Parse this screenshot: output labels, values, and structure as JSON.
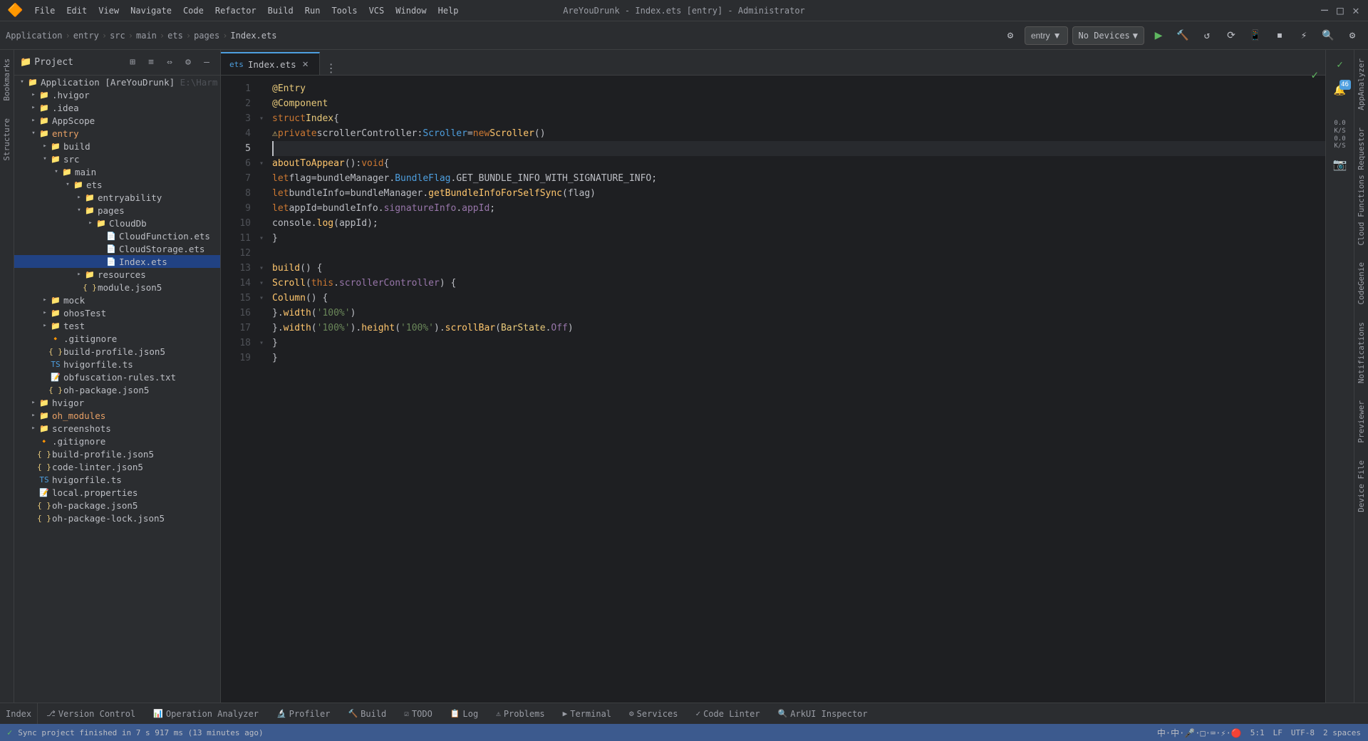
{
  "window": {
    "title": "AreYouDrunk - Index.ets [entry] - Administrator",
    "controls": [
      "–",
      "□",
      "✕"
    ]
  },
  "menu": {
    "logo": "🔶",
    "items": [
      "File",
      "Edit",
      "View",
      "Navigate",
      "Code",
      "Refactor",
      "Build",
      "Run",
      "Tools",
      "VCS",
      "Window",
      "Help"
    ]
  },
  "toolbar": {
    "breadcrumb": [
      "Application",
      "entry",
      "src",
      "main",
      "ets",
      "pages",
      "Index.ets"
    ],
    "entry_dropdown": "entry",
    "no_devices": "No Devices",
    "search_icon": "🔍",
    "settings_icon": "⚙"
  },
  "project_panel": {
    "title": "Project",
    "tree": [
      {
        "id": "app-root",
        "label": "Application [AreYouDrunk]",
        "suffix": "E:\\Harm",
        "indent": 0,
        "type": "dir-root",
        "expanded": true
      },
      {
        "id": "hvigor",
        "label": ".hvigor",
        "indent": 1,
        "type": "dir",
        "expanded": false
      },
      {
        "id": "idea",
        "label": ".idea",
        "indent": 1,
        "type": "dir",
        "expanded": false
      },
      {
        "id": "appscope",
        "label": "AppScope",
        "indent": 1,
        "type": "dir",
        "expanded": false
      },
      {
        "id": "entry",
        "label": "entry",
        "indent": 1,
        "type": "dir-orange",
        "expanded": true
      },
      {
        "id": "build",
        "label": "build",
        "indent": 2,
        "type": "dir",
        "expanded": false
      },
      {
        "id": "src",
        "label": "src",
        "indent": 2,
        "type": "dir",
        "expanded": true
      },
      {
        "id": "main",
        "label": "main",
        "indent": 3,
        "type": "dir",
        "expanded": true
      },
      {
        "id": "ets",
        "label": "ets",
        "indent": 4,
        "type": "dir",
        "expanded": true
      },
      {
        "id": "entryability",
        "label": "entryability",
        "indent": 5,
        "type": "dir",
        "expanded": false
      },
      {
        "id": "pages",
        "label": "pages",
        "indent": 5,
        "type": "dir",
        "expanded": true
      },
      {
        "id": "clouddb",
        "label": "CloudDb",
        "indent": 6,
        "type": "dir",
        "expanded": false
      },
      {
        "id": "cloudfunctionets",
        "label": "CloudFunction.ets",
        "indent": 6,
        "type": "file-ets"
      },
      {
        "id": "cloudstorageEts",
        "label": "CloudStorage.ets",
        "indent": 6,
        "type": "file-ets"
      },
      {
        "id": "indexets",
        "label": "Index.ets",
        "indent": 6,
        "type": "file-ets",
        "selected": true
      },
      {
        "id": "resources",
        "label": "resources",
        "indent": 4,
        "type": "dir",
        "expanded": false
      },
      {
        "id": "modulejson5",
        "label": "module.json5",
        "indent": 4,
        "type": "file-json"
      },
      {
        "id": "mock",
        "label": "mock",
        "indent": 2,
        "type": "dir",
        "expanded": false
      },
      {
        "id": "ohostest",
        "label": "ohosTest",
        "indent": 2,
        "type": "dir",
        "expanded": false
      },
      {
        "id": "test",
        "label": "test",
        "indent": 2,
        "type": "dir",
        "expanded": false
      },
      {
        "id": "gitignore1",
        "label": ".gitignore",
        "indent": 2,
        "type": "file-git"
      },
      {
        "id": "buildprofilejson5",
        "label": "build-profile.json5",
        "indent": 2,
        "type": "file-json"
      },
      {
        "id": "hvigorfile",
        "label": "hvigorfile.ts",
        "indent": 2,
        "type": "file-ts"
      },
      {
        "id": "obfuscation",
        "label": "obfuscation-rules.txt",
        "indent": 2,
        "type": "file-txt"
      },
      {
        "id": "ohpackage",
        "label": "oh-package.json5",
        "indent": 2,
        "type": "file-json"
      },
      {
        "id": "hvigor-dir",
        "label": "hvigor",
        "indent": 1,
        "type": "dir",
        "expanded": false
      },
      {
        "id": "oh_modules",
        "label": "oh_modules",
        "indent": 1,
        "type": "dir-orange",
        "expanded": false
      },
      {
        "id": "screenshots",
        "label": "screenshots",
        "indent": 1,
        "type": "dir",
        "expanded": false
      },
      {
        "id": "gitignore2",
        "label": ".gitignore",
        "indent": 1,
        "type": "file-git"
      },
      {
        "id": "buildprofile2",
        "label": "build-profile.json5",
        "indent": 1,
        "type": "file-json"
      },
      {
        "id": "codelinter",
        "label": "code-linter.json5",
        "indent": 1,
        "type": "file-json"
      },
      {
        "id": "hvigorfile2",
        "label": "hvigorfile.ts",
        "indent": 1,
        "type": "file-ts"
      },
      {
        "id": "localprops",
        "label": "local.properties",
        "indent": 1,
        "type": "file-txt"
      },
      {
        "id": "ohpackage2",
        "label": "oh-package.json5",
        "indent": 1,
        "type": "file-json"
      },
      {
        "id": "ohpackagelock",
        "label": "oh-package-lock.json5",
        "indent": 1,
        "type": "file-json"
      }
    ]
  },
  "editor": {
    "tab": "Index.ets",
    "lines": [
      {
        "n": 1,
        "code": "<dec>@Entry</dec>",
        "fold": false
      },
      {
        "n": 2,
        "code": "<dec>@Component</dec>",
        "fold": false
      },
      {
        "n": 3,
        "code": "<kw>struct</kw> <cls>Index</cls> {",
        "fold": true
      },
      {
        "n": 4,
        "code": "  <warn>⚠</warn><kw>private</kw> <plain>scrollerController</plain>: <type>Scroller</type> = <kw>new</kw> <fn>Scroller</fn>()",
        "fold": false
      },
      {
        "n": 5,
        "code": "  |",
        "fold": false,
        "cursor": true
      },
      {
        "n": 6,
        "code": "  <fn>aboutToAppear</fn>(): <kw>void</kw> {",
        "fold": true
      },
      {
        "n": 7,
        "code": "    <kw>let</kw> <plain>flag</plain> = <plain>bundleManager</plain>.<prop>BundleFlag</prop>.<prop>GET_BUNDLE_INFO_WITH_SIGNATURE_INFO</prop>;",
        "fold": false
      },
      {
        "n": 8,
        "code": "    <kw>let</kw> <plain>bundleInfo</plain> = <plain>bundleManager</plain>.<fn>getBundleInfoForSelfSync</fn>(<plain>flag</plain>)",
        "fold": false
      },
      {
        "n": 9,
        "code": "    <kw>let</kw> <plain>appId</plain> = <plain>bundleInfo</plain>.<prop>signatureInfo</prop>.<prop>appId</prop>;",
        "fold": false
      },
      {
        "n": 10,
        "code": "    <plain>console</plain>.<fn>log</fn>(<plain>appId</plain>);",
        "fold": false
      },
      {
        "n": 11,
        "code": "  }",
        "fold": true
      },
      {
        "n": 12,
        "code": "",
        "fold": false
      },
      {
        "n": 13,
        "code": "  <fn>build</fn>() {",
        "fold": true
      },
      {
        "n": 14,
        "code": "    <fn>Scroll</fn>(<kw>this</kw>.<prop>scrollerController</prop>) {",
        "fold": true
      },
      {
        "n": 15,
        "code": "      <fn>Column</fn>() {",
        "fold": true
      },
      {
        "n": 16,
        "code": "      }.<fn>width</fn>(<str>'100%'</str>)",
        "fold": false
      },
      {
        "n": 17,
        "code": "    }.<fn>width</fn>(<str>'100%'</str>).<fn>height</fn>(<str>'100%'</str>).<fn>scrollBar</fn>(<cls>BarState</cls>.<prop>Off</prop>)",
        "fold": false
      },
      {
        "n": 18,
        "code": "  }",
        "fold": true
      },
      {
        "n": 19,
        "code": "}",
        "fold": false
      }
    ]
  },
  "right_sidebar": {
    "check_icon": "✓",
    "badge_num": "46",
    "io_up": "0.0",
    "io_down": "0.0",
    "io_unit": "K/S",
    "camera_icon": "📷"
  },
  "vert_tabs_right": [
    "AppAnalyzer",
    "Cloud Functions Requestor",
    "CodeGenie",
    "Notifications",
    "Previewer",
    "Device File"
  ],
  "vert_tabs_left": [
    "Bookmarks",
    "Structure"
  ],
  "bottom_tabs": [
    {
      "label": "Version Control",
      "icon": "⎇",
      "active": false
    },
    {
      "label": "Operation Analyzer",
      "icon": "📊",
      "active": false
    },
    {
      "label": "Profiler",
      "icon": "🔬",
      "active": false
    },
    {
      "label": "Build",
      "icon": "🔨",
      "active": false
    },
    {
      "label": "TODO",
      "icon": "☑",
      "active": false
    },
    {
      "label": "Log",
      "icon": "📋",
      "active": false
    },
    {
      "label": "Problems",
      "icon": "⚠",
      "active": false
    },
    {
      "label": "Terminal",
      "icon": "▶",
      "active": false
    },
    {
      "label": "Services",
      "icon": "⚙",
      "active": false
    },
    {
      "label": "Code Linter",
      "icon": "✓",
      "active": false
    },
    {
      "label": "ArkUI Inspector",
      "icon": "🔍",
      "active": false
    }
  ],
  "bottom_left_tab": "Index",
  "status_bar": {
    "ok": "✓",
    "message": "Sync project finished in 7 s 917 ms (13 minutes ago)",
    "position": "5:1",
    "line_ending": "LF",
    "encoding": "UTF-8",
    "indent": "2 spaces",
    "chinese_input": "中·中·🎤·□·⌨·⚡·🔴"
  }
}
